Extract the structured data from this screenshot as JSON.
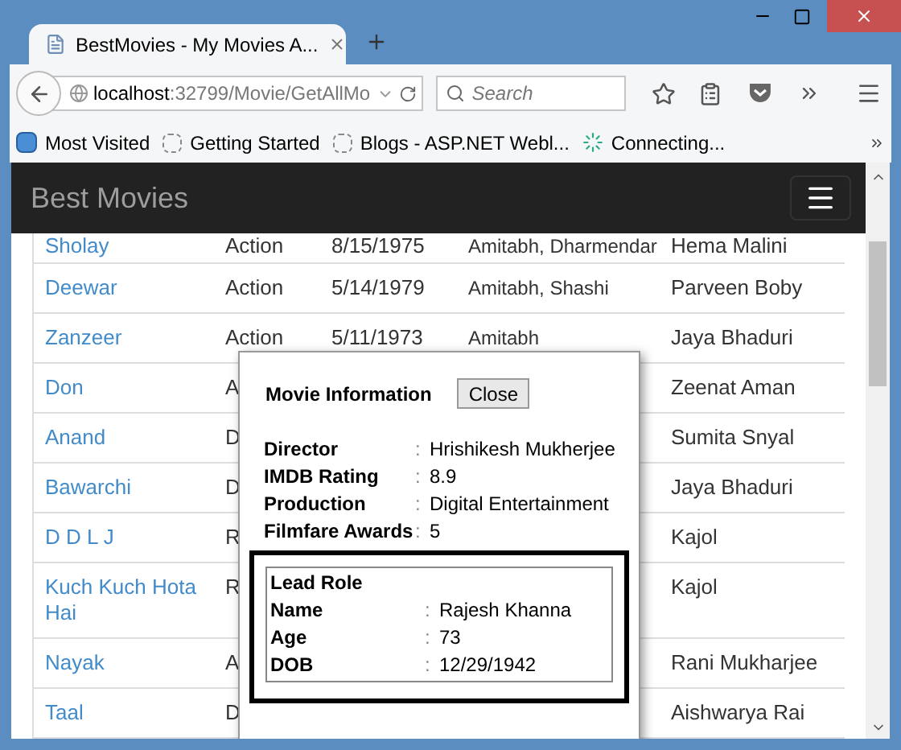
{
  "browser": {
    "tab_title": "BestMovies - My Movies A...",
    "url_host": "localhost",
    "url_rest": ":32799/Movie/GetAllMo",
    "search": {
      "placeholder": "Search"
    },
    "bookmarks": [
      {
        "kind": "library",
        "label": "Most Visited"
      },
      {
        "kind": "page",
        "label": "Getting Started"
      },
      {
        "kind": "page",
        "label": "Blogs - ASP.NET Webl..."
      },
      {
        "kind": "loading",
        "label": "Connecting..."
      }
    ]
  },
  "navbar": {
    "brand": "Best Movies"
  },
  "table": {
    "rows": [
      {
        "title": "Sholay",
        "genre": "Action",
        "date": "8/15/1975",
        "actors": "Amitabh, Dharmendar",
        "actress": "Hema Malini"
      },
      {
        "title": "Deewar",
        "genre": "Action",
        "date": "5/14/1979",
        "actors": "Amitabh, Shashi",
        "actress": "Parveen Boby"
      },
      {
        "title": "Zanzeer",
        "genre": "Action",
        "date": "5/11/1973",
        "actors": "Amitabh",
        "actress": "Jaya Bhaduri"
      },
      {
        "title": "Don",
        "genre": "A",
        "actress": "Zeenat Aman"
      },
      {
        "title": "Anand",
        "genre": "D",
        "actress": "Sumita Snyal"
      },
      {
        "title": "Bawarchi",
        "genre": "D",
        "actress": "Jaya Bhaduri"
      },
      {
        "title": "D D L J",
        "genre": "R",
        "actress": "Kajol"
      },
      {
        "title": "Kuch Kuch Hota Hai",
        "genre": "R",
        "actress": "Kajol"
      },
      {
        "title": "Nayak",
        "genre": "A",
        "actress": "Rani Mukharjee"
      },
      {
        "title": "Taal",
        "genre": "D",
        "actress": "Aishwarya Rai"
      }
    ]
  },
  "modal": {
    "title": "Movie Information",
    "close": "Close",
    "details": [
      {
        "label": "Director",
        "sep": ":",
        "value": "Hrishikesh Mukherjee"
      },
      {
        "label": "IMDB Rating",
        "sep": ":",
        "value": "8.9"
      },
      {
        "label": "Production",
        "sep": ":",
        "value": "Digital Entertainment"
      },
      {
        "label": "Filmfare Awards",
        "sep": ":",
        "value": "5"
      }
    ],
    "lead_role": {
      "heading": "Lead Role",
      "details": [
        {
          "label": "Name",
          "sep": ":",
          "value": "Rajesh Khanna"
        },
        {
          "label": "Age",
          "sep": ":",
          "value": "73"
        },
        {
          "label": "DOB",
          "sep": ":",
          "value": "12/29/1942"
        }
      ]
    }
  }
}
